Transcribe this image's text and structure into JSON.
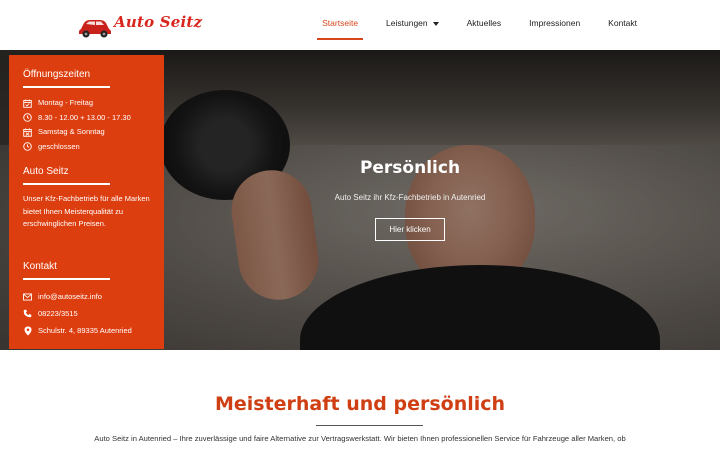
{
  "brand": {
    "name": "Auto Seitz",
    "color": "#d8261d"
  },
  "nav": {
    "items": [
      {
        "label": "Startseite",
        "active": true
      },
      {
        "label": "Leistungen",
        "dropdown": true
      },
      {
        "label": "Aktuelles"
      },
      {
        "label": "Impressionen"
      },
      {
        "label": "Kontakt"
      }
    ]
  },
  "hero": {
    "title": "Persönlich",
    "subtitle": "Auto Seitz ihr Kfz-Fachbetrieb in Autenried",
    "button_label": "Hier klicken"
  },
  "panel": {
    "accent": "#dd3e0f",
    "hours": {
      "heading": "Öffnungszeiten",
      "rows": [
        {
          "icon": "calendar-icon",
          "text": "Montag - Freitag"
        },
        {
          "icon": "clock-icon",
          "text": "8.30 - 12.00 + 13.00 - 17.30"
        },
        {
          "icon": "calendar-icon",
          "text": "Samstag & Sonntag"
        },
        {
          "icon": "clock-icon",
          "text": "geschlossen"
        }
      ]
    },
    "about": {
      "heading": "Auto Seitz",
      "text": "Unser Kfz-Fachbetrieb für alle Marken bietet Ihnen Meisterqualität zu erschwinglichen Preisen."
    },
    "contact": {
      "heading": "Kontakt",
      "email": "info@autoseitz.info",
      "phone": "08223/3515",
      "address": "Schulstr. 4, 89335 Autenried"
    }
  },
  "intro": {
    "title": "Meisterhaft und persönlich",
    "line1": "Auto Seitz in Autenried – Ihre zuverlässige und faire Alternative zur Vertragswerkstatt. Wir bieten Ihnen professionellen Service für Fahrzeuge aller Marken, ob",
    "title_color": "#cf3f13"
  }
}
